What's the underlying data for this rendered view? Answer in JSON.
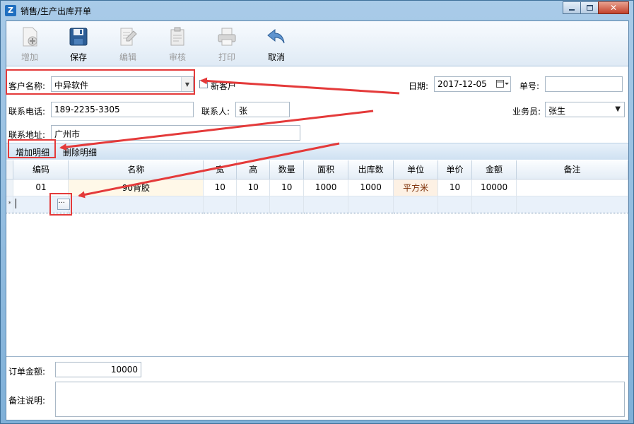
{
  "window": {
    "title": "销售/生产出库开单",
    "controls": [
      "minimize",
      "maximize",
      "close"
    ]
  },
  "toolbar": {
    "buttons": [
      {
        "label": "增加",
        "icon": "add-document-icon",
        "enabled": false
      },
      {
        "label": "保存",
        "icon": "save-disk-icon",
        "enabled": true
      },
      {
        "label": "编辑",
        "icon": "edit-document-icon",
        "enabled": false
      },
      {
        "label": "审核",
        "icon": "clipboard-check-icon",
        "enabled": false
      },
      {
        "label": "打印",
        "icon": "printer-icon",
        "enabled": false
      },
      {
        "label": "取消",
        "icon": "undo-arrow-icon",
        "enabled": true
      }
    ]
  },
  "form": {
    "customer_label": "客户名称:",
    "customer_value": "中异软件",
    "new_customer_label": "新客户",
    "date_label": "日期:",
    "date_value": "2017-12-05",
    "order_no_label": "单号:",
    "order_no_value": "",
    "phone_label": "联系电话:",
    "phone_value": "189-2235-3305",
    "contact_label": "联系人:",
    "contact_value": "张",
    "salesman_label": "业务员:",
    "salesman_value": "张生",
    "address_label": "联系地址:",
    "address_value": "广州市"
  },
  "detail_toolbar": {
    "add_label": "增加明细",
    "delete_label": "删除明细"
  },
  "grid": {
    "columns": [
      "编码",
      "名称",
      "宽",
      "高",
      "数量",
      "面积",
      "出库数",
      "单位",
      "单价",
      "金额",
      "备注"
    ],
    "rows": [
      {
        "code": "01",
        "name": "90背胶",
        "width": "10",
        "height": "10",
        "qty": "10",
        "area": "1000",
        "out_qty": "1000",
        "unit": "平方米",
        "price": "10",
        "amount": "10000",
        "note": ""
      }
    ],
    "new_row_marker": "*",
    "ellipsis": "···"
  },
  "footer": {
    "total_label": "订单金额:",
    "total_value": "10000",
    "remark_label": "备注说明:",
    "remark_value": ""
  },
  "colors": {
    "annotation_red": "#e43a3a",
    "frame_blue": "#7fb0d8",
    "unit_text": "#7a2a00"
  }
}
